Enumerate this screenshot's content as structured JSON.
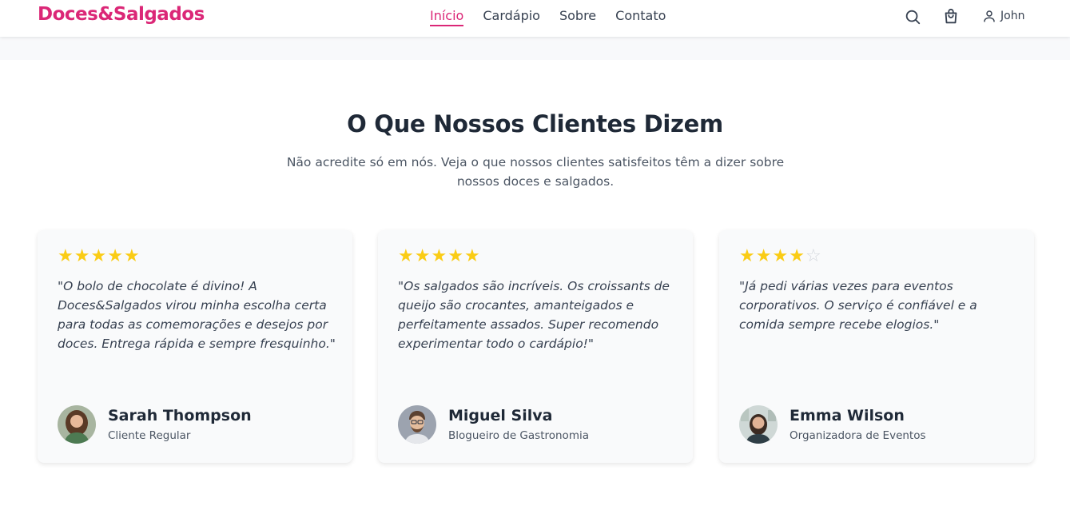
{
  "header": {
    "logo": "Doces&Salgados",
    "nav": [
      {
        "label": "Início",
        "active": true
      },
      {
        "label": "Cardápio",
        "active": false
      },
      {
        "label": "Sobre",
        "active": false
      },
      {
        "label": "Contato",
        "active": false
      }
    ],
    "user_name": "John",
    "icons": [
      "search-icon",
      "cart-icon",
      "user-icon"
    ]
  },
  "colors": {
    "brand": "#db2777",
    "star": "#facc15",
    "star_empty": "#d1d5db"
  },
  "testimonials_section": {
    "title": "O Que Nossos Clientes Dizem",
    "subtitle": "Não acredite só em nós. Veja o que nossos clientes satisfeitos têm a dizer sobre nossos doces e salgados.",
    "cards": [
      {
        "rating": 5,
        "quote": "\"O bolo de chocolate é divino! A Doces&Salgados virou minha escolha certa para todas as comemorações e desejos por doces. Entrega rápida e sempre fresquinho.\"",
        "name": "Sarah Thompson",
        "role": "Cliente Regular"
      },
      {
        "rating": 5,
        "quote": "\"Os salgados são incríveis. Os croissants de queijo são crocantes, amanteigados e perfeitamente assados. Super recomendo experimentar todo o cardápio!\"",
        "name": "Miguel Silva",
        "role": "Blogueiro de Gastronomia"
      },
      {
        "rating": 4,
        "quote": "\"Já pedi várias vezes para eventos corporativos. O serviço é confiável e a comida sempre recebe elogios.\"",
        "name": "Emma Wilson",
        "role": "Organizadora de Eventos"
      }
    ]
  }
}
